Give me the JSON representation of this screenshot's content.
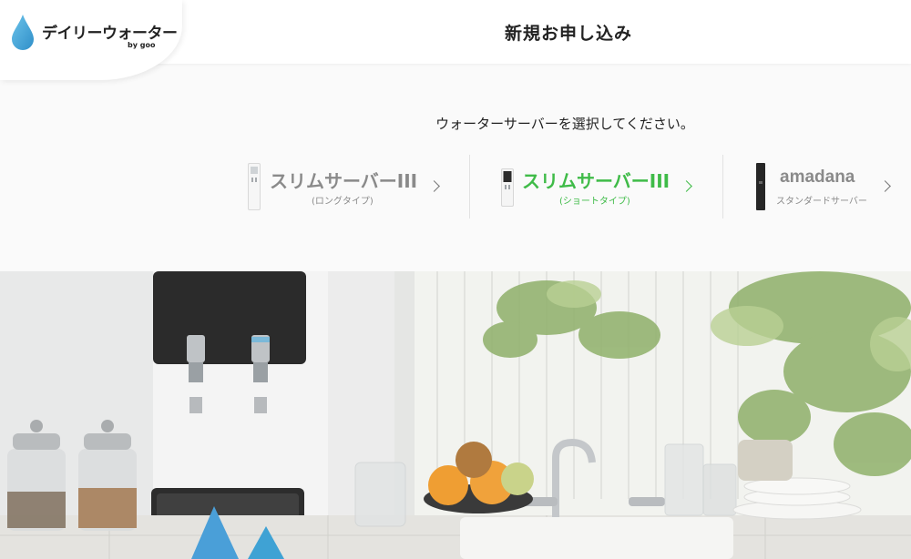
{
  "header": {
    "logo_text": "デイリーウォーター",
    "logo_sub": "by goo",
    "title": "新規お申し込み"
  },
  "selection": {
    "instruction": "ウォーターサーバーを選択してください。",
    "servers": [
      {
        "name": "スリムサーバーIII",
        "subtitle": "(ロングタイプ)",
        "color": "#8a8a8a",
        "selected": false
      },
      {
        "name": "スリムサーバーIII",
        "subtitle": "(ショートタイプ)",
        "color": "#3fbb48",
        "selected": true
      },
      {
        "name": "amadana",
        "subtitle": "スタンダードサーバー",
        "color": "#8a8a8a",
        "selected": false
      }
    ]
  },
  "colors": {
    "accent_green": "#3fbb48",
    "logo_blue": "#4aa7d9",
    "inactive_gray": "#8a8a8a"
  }
}
